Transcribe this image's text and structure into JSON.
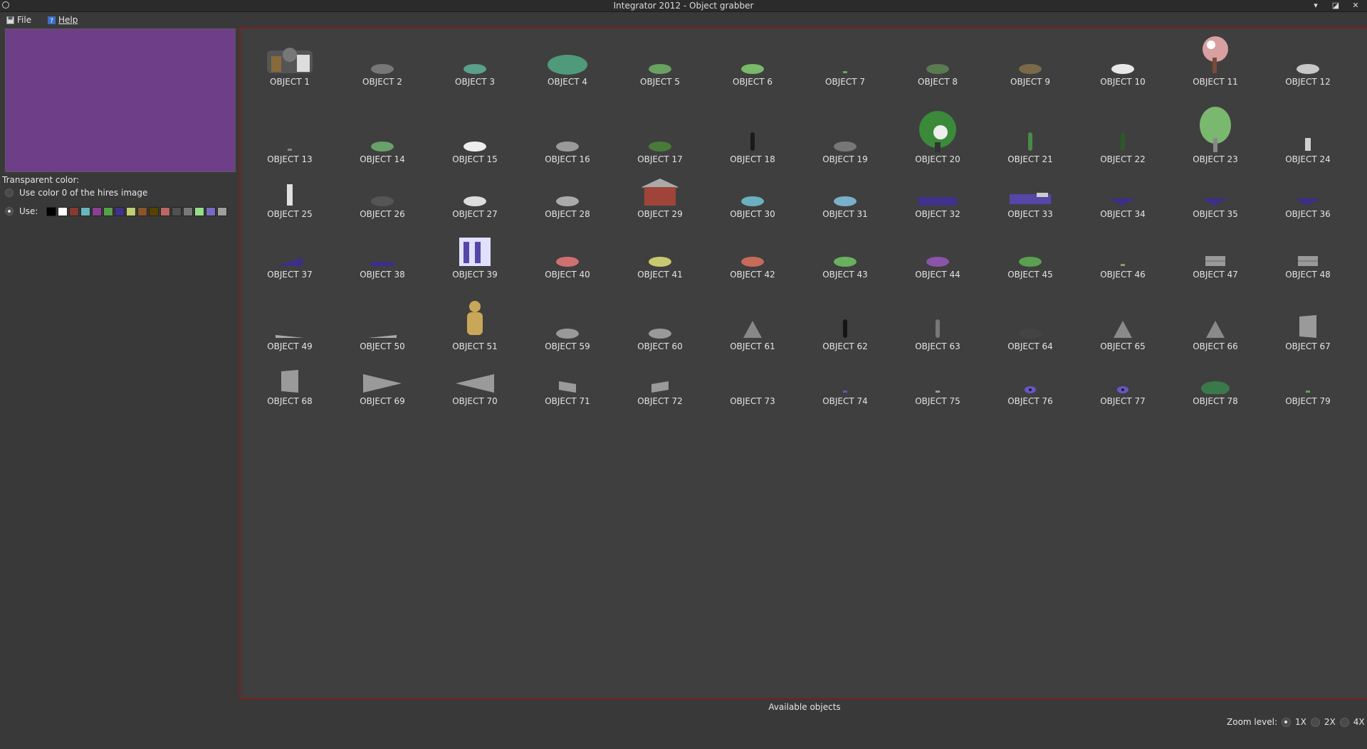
{
  "window": {
    "title": "Integrator 2012 - Object grabber"
  },
  "menu": {
    "file": "File",
    "help": "Help"
  },
  "transparent": {
    "heading": "Transparent color:",
    "option_hires": "Use color 0 of the hires image",
    "option_use": "Use:",
    "selected": "use",
    "palette": [
      "#000000",
      "#ffffff",
      "#883932",
      "#67b6bd",
      "#8b3f96",
      "#55a049",
      "#40318d",
      "#bfce72",
      "#8b5429",
      "#574200",
      "#b86962",
      "#505050",
      "#787878",
      "#94e089",
      "#7869c4",
      "#9f9f9f"
    ]
  },
  "objects": [
    {
      "label": "OBJECT 1",
      "icon": "rocky-shrine",
      "color": "#8a6a3a"
    },
    {
      "label": "OBJECT 2",
      "icon": "small-rock",
      "color": "#777777"
    },
    {
      "label": "OBJECT 3",
      "icon": "green-bush",
      "color": "#5aa08a"
    },
    {
      "label": "OBJECT 4",
      "icon": "large-bush",
      "color": "#4f9a7a"
    },
    {
      "label": "OBJECT 5",
      "icon": "small-bush",
      "color": "#6aa060"
    },
    {
      "label": "OBJECT 6",
      "icon": "grass-tuft",
      "color": "#7ab86a"
    },
    {
      "label": "OBJECT 7",
      "icon": "tiny-sprout",
      "color": "#66aa55"
    },
    {
      "label": "OBJECT 8",
      "icon": "mound-bush",
      "color": "#5a7a50"
    },
    {
      "label": "OBJECT 9",
      "icon": "branch",
      "color": "#7a6a4a"
    },
    {
      "label": "OBJECT 10",
      "icon": "white-flower",
      "color": "#e8e8e8"
    },
    {
      "label": "OBJECT 11",
      "icon": "blossom-tree",
      "color": "#d8a0a0"
    },
    {
      "label": "OBJECT 12",
      "icon": "small-post",
      "color": "#c8c8c8"
    },
    {
      "label": "OBJECT 13",
      "icon": "pebble",
      "color": "#888888"
    },
    {
      "label": "OBJECT 14",
      "icon": "fern",
      "color": "#6aa06a"
    },
    {
      "label": "OBJECT 15",
      "icon": "white-grass",
      "color": "#eeeeee"
    },
    {
      "label": "OBJECT 16",
      "icon": "reeds",
      "color": "#9a9a9a"
    },
    {
      "label": "OBJECT 17",
      "icon": "bonsai",
      "color": "#4a7a3a"
    },
    {
      "label": "OBJECT 18",
      "icon": "dark-figure",
      "color": "#1a1a1a"
    },
    {
      "label": "OBJECT 19",
      "icon": "rubble",
      "color": "#777777"
    },
    {
      "label": "OBJECT 20",
      "icon": "green-tree",
      "color": "#3a8a3a"
    },
    {
      "label": "OBJECT 21",
      "icon": "thin-plant",
      "color": "#4a8a4a"
    },
    {
      "label": "OBJECT 22",
      "icon": "cypress",
      "color": "#2a5a2a"
    },
    {
      "label": "OBJECT 23",
      "icon": "willow-tree",
      "color": "#7ab870"
    },
    {
      "label": "OBJECT 24",
      "icon": "pagoda-small",
      "color": "#d0d0d0"
    },
    {
      "label": "OBJECT 25",
      "icon": "pagoda-tall",
      "color": "#e0e0e0"
    },
    {
      "label": "OBJECT 26",
      "icon": "log",
      "color": "#555555"
    },
    {
      "label": "OBJECT 27",
      "icon": "white-dots",
      "color": "#dddddd"
    },
    {
      "label": "OBJECT 28",
      "icon": "gravel",
      "color": "#aaaaaa"
    },
    {
      "label": "OBJECT 29",
      "icon": "red-house",
      "color": "#a0443a"
    },
    {
      "label": "OBJECT 30",
      "icon": "fountain",
      "color": "#6ab0c0"
    },
    {
      "label": "OBJECT 31",
      "icon": "water-rock",
      "color": "#7ab0c8"
    },
    {
      "label": "OBJECT 32",
      "icon": "water-pool",
      "color": "#40318d"
    },
    {
      "label": "OBJECT 33",
      "icon": "water-wave",
      "color": "#5546a8"
    },
    {
      "label": "OBJECT 34",
      "icon": "water-wedge",
      "color": "#3d2e8a"
    },
    {
      "label": "OBJECT 35",
      "icon": "water-wedge",
      "color": "#3d2e8a"
    },
    {
      "label": "OBJECT 36",
      "icon": "water-wedge",
      "color": "#3d2e8a"
    },
    {
      "label": "OBJECT 37",
      "icon": "water-ramp",
      "color": "#3d2e8a"
    },
    {
      "label": "OBJECT 38",
      "icon": "water-strip",
      "color": "#3d2e8a"
    },
    {
      "label": "OBJECT 39",
      "icon": "waterfall",
      "color": "#e0e0ff"
    },
    {
      "label": "OBJECT 40",
      "icon": "flowers-red",
      "color": "#d07070"
    },
    {
      "label": "OBJECT 41",
      "icon": "flowers-yellow",
      "color": "#c8c870"
    },
    {
      "label": "OBJECT 42",
      "icon": "flowers-orange",
      "color": "#c86a5a"
    },
    {
      "label": "OBJECT 43",
      "icon": "green-patch",
      "color": "#6ab060"
    },
    {
      "label": "OBJECT 44",
      "icon": "purple-shrub",
      "color": "#8a55a8"
    },
    {
      "label": "OBJECT 45",
      "icon": "green-shrub",
      "color": "#5aa050"
    },
    {
      "label": "OBJECT 46",
      "icon": "tiny-leaf",
      "color": "#8aa060"
    },
    {
      "label": "OBJECT 47",
      "icon": "stone-wall",
      "color": "#9a9a9a"
    },
    {
      "label": "OBJECT 48",
      "icon": "stone-wall",
      "color": "#9a9a9a"
    },
    {
      "label": "OBJECT 49",
      "icon": "flat-slab",
      "color": "#aaaaaa"
    },
    {
      "label": "OBJECT 50",
      "icon": "flat-slab-2",
      "color": "#aaaaaa"
    },
    {
      "label": "OBJECT 51",
      "icon": "buddha",
      "color": "#c8a858"
    },
    {
      "label": "OBJECT 59",
      "icon": "small-stone",
      "color": "#999999"
    },
    {
      "label": "OBJECT 60",
      "icon": "small-stone",
      "color": "#999999"
    },
    {
      "label": "OBJECT 61",
      "icon": "boulder",
      "color": "#888888"
    },
    {
      "label": "OBJECT 62",
      "icon": "dark-tree",
      "color": "#151515"
    },
    {
      "label": "OBJECT 63",
      "icon": "stick",
      "color": "#777777"
    },
    {
      "label": "OBJECT 64",
      "icon": "twig",
      "color": "#444444"
    },
    {
      "label": "OBJECT 65",
      "icon": "large-boulder",
      "color": "#8a8a8a"
    },
    {
      "label": "OBJECT 66",
      "icon": "rock-spire",
      "color": "#8a8a8a"
    },
    {
      "label": "OBJECT 67",
      "icon": "grey-panel",
      "color": "#9a9a9a"
    },
    {
      "label": "OBJECT 68",
      "icon": "grey-panel",
      "color": "#9a9a9a"
    },
    {
      "label": "OBJECT 69",
      "icon": "grey-wedge-right",
      "color": "#9a9a9a"
    },
    {
      "label": "OBJECT 70",
      "icon": "grey-wedge-left",
      "color": "#9a9a9a"
    },
    {
      "label": "OBJECT 71",
      "icon": "grey-tile",
      "color": "#9a9a9a"
    },
    {
      "label": "OBJECT 72",
      "icon": "grey-tile-2",
      "color": "#9a9a9a"
    },
    {
      "label": "OBJECT 73",
      "icon": "empty",
      "color": "#3f3f3f"
    },
    {
      "label": "OBJECT 74",
      "icon": "tiny-purple",
      "color": "#6a55a8"
    },
    {
      "label": "OBJECT 75",
      "icon": "tiny-grey",
      "color": "#999999"
    },
    {
      "label": "OBJECT 76",
      "icon": "purple-eye",
      "color": "#6a55c8"
    },
    {
      "label": "OBJECT 77",
      "icon": "purple-eye",
      "color": "#6a55c8"
    },
    {
      "label": "OBJECT 78",
      "icon": "dark-bush",
      "color": "#3a7a4a"
    },
    {
      "label": "OBJECT 79",
      "icon": "tiny-sprout",
      "color": "#6aa060"
    }
  ],
  "panel_caption": "Available objects",
  "zoom": {
    "label": "Zoom level:",
    "options": [
      "1X",
      "2X",
      "4X"
    ],
    "selected": "1X"
  }
}
